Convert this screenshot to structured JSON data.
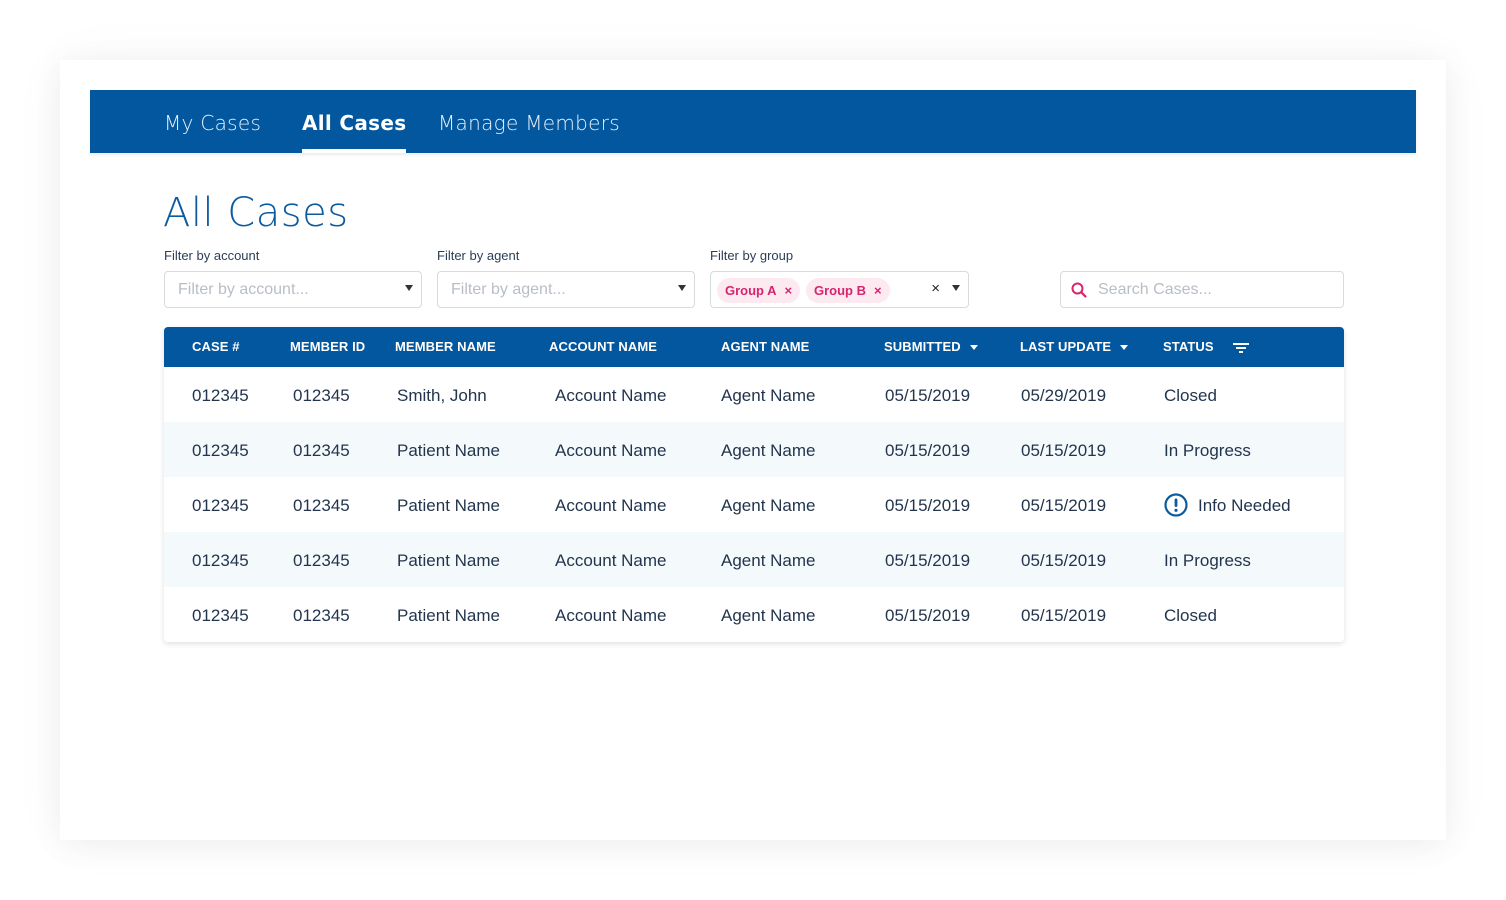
{
  "nav": {
    "tabs": [
      {
        "label": "My Cases",
        "active": false
      },
      {
        "label": "All Cases",
        "active": true
      },
      {
        "label": "Manage Members",
        "active": false
      }
    ]
  },
  "page": {
    "title": "All Cases"
  },
  "filters": {
    "account": {
      "label": "Filter by account",
      "placeholder": "Filter by account..."
    },
    "agent": {
      "label": "Filter by agent",
      "placeholder": "Filter by agent..."
    },
    "group": {
      "label": "Filter by group",
      "chips": [
        {
          "label": "Group A",
          "remove_icon": "×"
        },
        {
          "label": "Group B",
          "remove_icon": "×"
        }
      ],
      "clear_icon": "×"
    },
    "search": {
      "placeholder": "Search Cases..."
    }
  },
  "table": {
    "columns": [
      "CASE #",
      "MEMBER ID",
      "MEMBER NAME",
      "ACCOUNT NAME",
      "AGENT NAME",
      "SUBMITTED",
      "LAST UPDATE",
      "STATUS"
    ],
    "rows": [
      {
        "case": "012345",
        "member_id": "012345",
        "member_name": "Smith, John",
        "account": "Account Name",
        "agent": "Agent Name",
        "submitted": "05/15/2019",
        "last_update": "05/29/2019",
        "status": "Closed"
      },
      {
        "case": "012345",
        "member_id": "012345",
        "member_name": "Patient Name",
        "account": "Account Name",
        "agent": "Agent Name",
        "submitted": "05/15/2019",
        "last_update": "05/15/2019",
        "status": "In Progress"
      },
      {
        "case": "012345",
        "member_id": "012345",
        "member_name": "Patient Name",
        "account": "Account Name",
        "agent": "Agent Name",
        "submitted": "05/15/2019",
        "last_update": "05/15/2019",
        "status": "Info Needed",
        "status_icon": "exclamation-circle-icon"
      },
      {
        "case": "012345",
        "member_id": "012345",
        "member_name": "Patient Name",
        "account": "Account Name",
        "agent": "Agent Name",
        "submitted": "05/15/2019",
        "last_update": "05/15/2019",
        "status": "In Progress"
      },
      {
        "case": "012345",
        "member_id": "012345",
        "member_name": "Patient Name",
        "account": "Account Name",
        "agent": "Agent Name",
        "submitted": "05/15/2019",
        "last_update": "05/15/2019",
        "status": "Closed"
      }
    ]
  },
  "colors": {
    "brand_blue": "#02579e",
    "accent_pink": "#d6246e",
    "chip_bg": "#fdeaf1",
    "row_alt": "#f4f9fc"
  }
}
